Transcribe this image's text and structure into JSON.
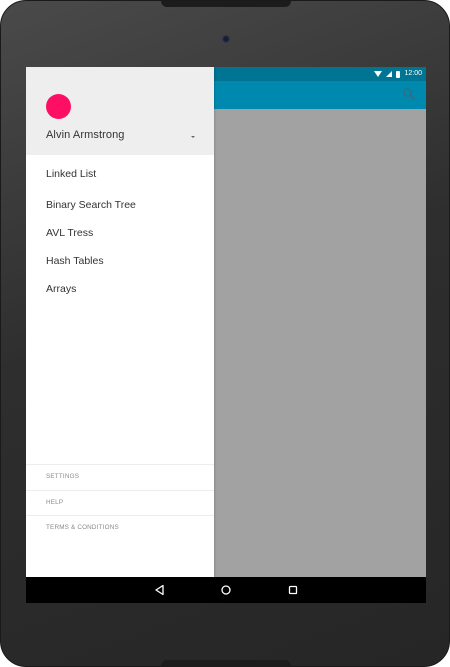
{
  "status_bar": {
    "time": "12:00",
    "icons": [
      "wifi-icon",
      "signal-icon",
      "battery-icon"
    ],
    "background": "#007493"
  },
  "app_bar": {
    "background": "#0089ae",
    "actions": [
      "search-icon"
    ]
  },
  "drawer": {
    "account": {
      "name": "Alvin Armstrong",
      "avatar_color": "#ff0f64"
    },
    "items": [
      {
        "label": "Linked List"
      },
      {
        "label": "Binary Search Tree"
      },
      {
        "label": "AVL Tress"
      },
      {
        "label": "Hash Tables"
      },
      {
        "label": "Arrays"
      }
    ],
    "footer": [
      {
        "label": "SETTINGS"
      },
      {
        "label": "HELP"
      },
      {
        "label": "TERMS & CONDITIONS"
      }
    ]
  },
  "system_nav": {
    "buttons": [
      "back-icon",
      "home-icon",
      "recents-icon"
    ]
  }
}
